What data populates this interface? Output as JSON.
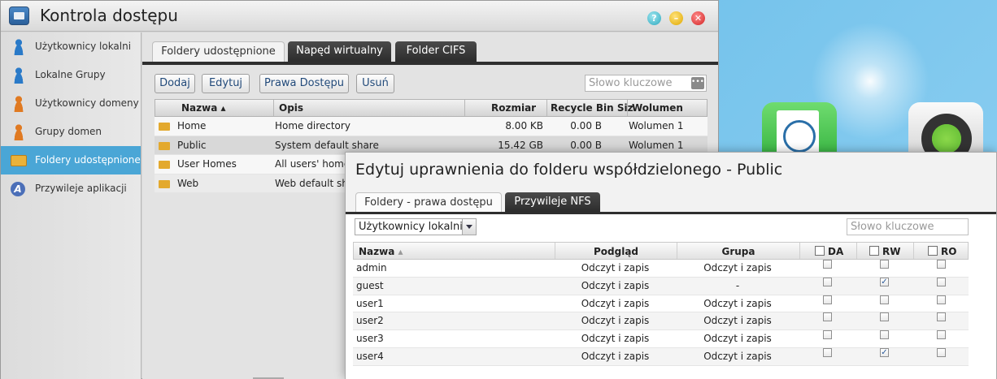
{
  "window": {
    "title": "Kontrola dostępu",
    "controls": [
      "help-icon",
      "minimize-icon",
      "close-icon"
    ]
  },
  "sidebar": {
    "items": [
      {
        "label": "Użytkownicy lokalni",
        "icon": "user-icon"
      },
      {
        "label": "Lokalne Grupy",
        "icon": "group-icon"
      },
      {
        "label": "Użytkownicy domeny",
        "icon": "domain-user-icon"
      },
      {
        "label": "Grupy domen",
        "icon": "domain-group-icon"
      },
      {
        "label": "Foldery udostępnione",
        "icon": "shared-folder-icon",
        "active": true
      },
      {
        "label": "Przywileje aplikacji",
        "icon": "app-privilege-icon"
      }
    ]
  },
  "main": {
    "tabs": [
      "Foldery udostępnione",
      "Napęd wirtualny",
      "Folder CIFS"
    ],
    "toolbar": {
      "add": "Dodaj",
      "edit": "Edytuj",
      "rights": "Prawa Dostępu",
      "delete": "Usuń"
    },
    "search_placeholder": "Słowo kluczowe",
    "columns": [
      "Nazwa",
      "Opis",
      "Rozmiar",
      "Recycle Bin Siz",
      "Wolumen"
    ],
    "rows": [
      {
        "name": "Home",
        "desc": "Home directory",
        "size": "8.00 KB",
        "recycle": "0.00 B",
        "volume": "Wolumen 1"
      },
      {
        "name": "Public",
        "desc": "System default share",
        "size": "15.42 GB",
        "recycle": "0.00 B",
        "volume": "Wolumen 1"
      },
      {
        "name": "User Homes",
        "desc": "All users' home",
        "size": "",
        "recycle": "",
        "volume": ""
      },
      {
        "name": "Web",
        "desc": "Web default sh",
        "size": "",
        "recycle": "",
        "volume": ""
      }
    ]
  },
  "dialog": {
    "title": "Edytuj uprawnienia do folderu współdzielonego - Public",
    "tabs": [
      "Foldery - prawa dostępu",
      "Przywileje NFS"
    ],
    "select_value": "Użytkownicy lokalni",
    "search_placeholder": "Słowo kluczowe",
    "columns": [
      "Nazwa",
      "Podgląd",
      "Grupa",
      "DA",
      "RW",
      "RO"
    ],
    "rows": [
      {
        "name": "admin",
        "preview": "Odczyt i zapis",
        "group": "Odczyt i zapis",
        "da": false,
        "rw": false,
        "ro": false
      },
      {
        "name": "guest",
        "preview": "Odczyt i zapis",
        "group": "-",
        "da": false,
        "rw": true,
        "ro": false
      },
      {
        "name": "user1",
        "preview": "Odczyt i zapis",
        "group": "Odczyt i zapis",
        "da": false,
        "rw": false,
        "ro": false
      },
      {
        "name": "user2",
        "preview": "Odczyt i zapis",
        "group": "Odczyt i zapis",
        "da": false,
        "rw": false,
        "ro": false
      },
      {
        "name": "user3",
        "preview": "Odczyt i zapis",
        "group": "Odczyt i zapis",
        "da": false,
        "rw": false,
        "ro": false
      },
      {
        "name": "user4",
        "preview": "Odczyt i zapis",
        "group": "Odczyt i zapis",
        "da": false,
        "rw": true,
        "ro": false
      }
    ]
  }
}
